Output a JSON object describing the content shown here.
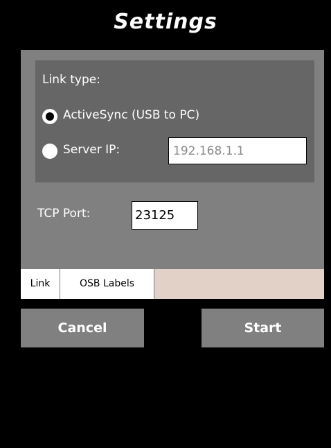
{
  "header": {
    "title": "Settings"
  },
  "link_group": {
    "heading": "Link type:",
    "options": [
      {
        "label": "ActiveSync (USB to PC)",
        "selected": true
      },
      {
        "label": "Server IP:",
        "selected": false
      }
    ],
    "server_ip": {
      "value": "192.168.1.1"
    }
  },
  "tcp": {
    "label": "TCP Port:",
    "value": "23125"
  },
  "tabs": [
    {
      "label": "Link",
      "active": true
    },
    {
      "label": "OSB Labels",
      "active": false
    }
  ],
  "buttons": {
    "cancel": "Cancel",
    "start": "Start"
  },
  "colors": {
    "background": "#000000",
    "panel": "#808080",
    "group": "#666666",
    "tab_strip": "#e2d1c6",
    "button": "#808080"
  }
}
